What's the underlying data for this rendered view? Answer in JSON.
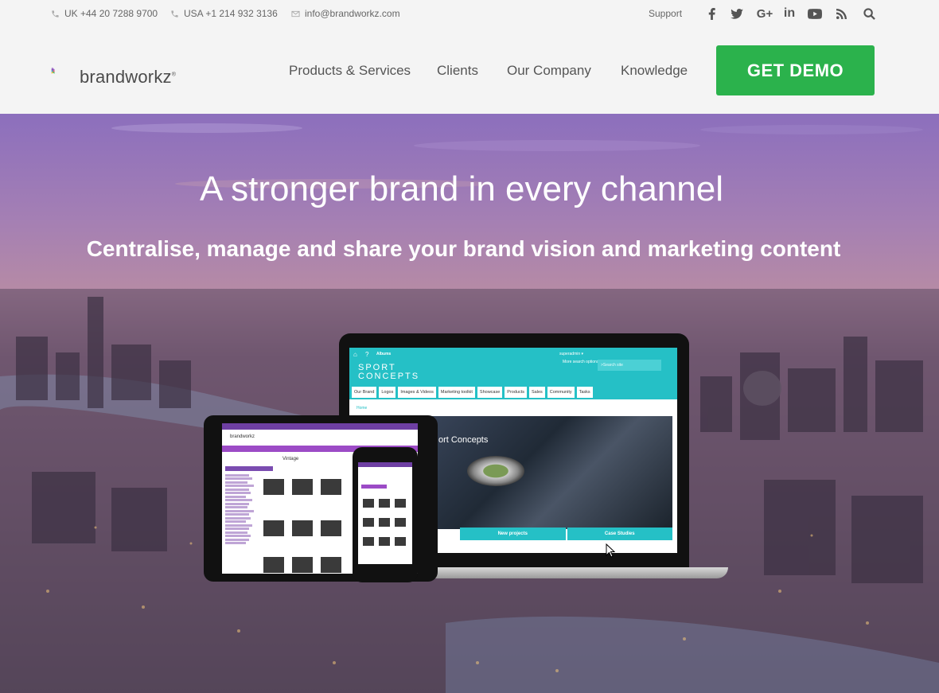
{
  "topbar": {
    "phone_uk": "UK +44 20 7288 9700",
    "phone_usa": "USA +1 214 932 3136",
    "email": "info@brandworkz.com",
    "support": "Support",
    "social_icons": [
      "facebook-icon",
      "twitter-icon",
      "google-plus-icon",
      "linkedin-icon",
      "youtube-icon",
      "rss-icon",
      "search-icon"
    ]
  },
  "header": {
    "logo_text": "brandworkz",
    "logo_mark": "®",
    "nav": [
      "Products & Services",
      "Clients",
      "Our Company",
      "Knowledge"
    ],
    "demo_button": "GET DEMO"
  },
  "hero": {
    "title": "A stronger brand in every channel",
    "subtitle": "Centralise, manage and share your brand vision and marketing content"
  },
  "laptop_app": {
    "albums": "Albums",
    "user": "superadmin ▾",
    "more_search": "More search options",
    "search_placeholder": ">Search site",
    "brand_line1": "SPORT",
    "brand_line2": "CONCEPTS",
    "tabs": [
      "Our Brand",
      "Logos",
      "Images & Videos",
      "Marketing toolkit",
      "Showcase",
      "Products",
      "Sales",
      "Community",
      "Tasks"
    ],
    "home": "Home",
    "slide_label": "ort Concepts",
    "cta_left": "New projects",
    "cta_right": "Case Studies"
  },
  "tablet_app": {
    "brand": "brandworkz",
    "breadcrumb": "Vintage"
  },
  "colors": {
    "demo_green": "#2bb24c",
    "app_teal": "#25c0c6",
    "app_purple": "#6e3fa3"
  }
}
